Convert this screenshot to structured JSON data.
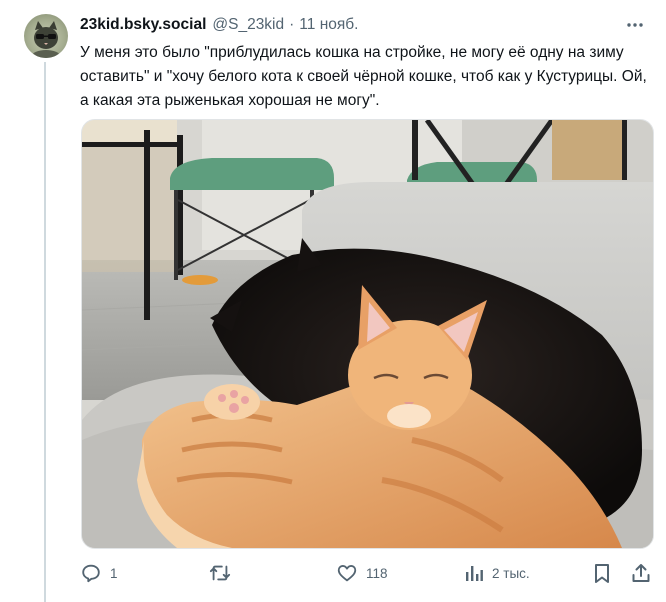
{
  "post": {
    "display_name": "23kid.bsky.social",
    "handle": "@S_23kid",
    "separator": "·",
    "time": "11 нояб.",
    "text": "У меня это было \"приблудилась кошка на стройке, не могу её одну на зиму оставить\" и \"хочу белого кота к своей чёрной кошке, чтоб как у Кустурицы. Ой, а какая эта рыженькая хорошая не могу\"."
  },
  "actions": {
    "replies": "1",
    "reposts": "",
    "likes": "118",
    "views": "2 тыс."
  },
  "icons": {
    "more": "more-dots-icon",
    "reply": "reply-icon",
    "repost": "repost-icon",
    "like": "heart-icon",
    "views": "views-bar-chart-icon",
    "bookmark": "bookmark-icon",
    "share": "share-icon"
  },
  "colors": {
    "text": "#0f1419",
    "secondary": "#536471",
    "thread_line": "#cfd9de"
  }
}
